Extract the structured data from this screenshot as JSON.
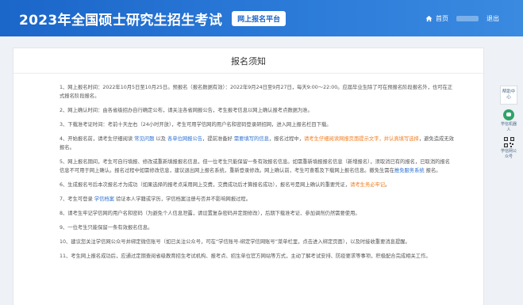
{
  "header": {
    "title": "2023年全国硕士研究生招生考试",
    "badge": "网上报名平台",
    "home_label": "首页",
    "logout_label": "退出"
  },
  "page": {
    "title": "报名须知"
  },
  "side": {
    "help_label": "帮助中心",
    "robot_label": "学信机器人",
    "qr_label": "学信网公众号"
  },
  "notice": {
    "p1": "1、网上报名时间：2022年10月5日至10月25日。预报名（报名数据有效）：2022年9月24日至9月27日，每天9:00～22:00。应届毕业生除了可在预报名阶段报名外，也可在正式报名阶段报名。",
    "p2": "2、网上确认时间：由各省级招办自行确定公布，请关注各省网报公告，考生报考信息以网上确认报考点数据为准。",
    "p3": "3、下载准考证时间：考前十天左右（24小时开放），考生可用学信网的用户名和密码登录研招网，进入网上报名栏目下载。",
    "p4": {
      "t1": "4、开始报名前，请考生仔细阅读 ",
      "l1": "常见问题",
      "t2": " 以及 ",
      "l2": "各单位网报公告",
      "t3": "，提前准备好 ",
      "l3": "需要填写的信息",
      "t4": "，报名过程中，",
      "w1": "请考生仔细阅读网报页面提示文字，并认真填写选择",
      "t5": "，避免造成无效报名。"
    },
    "p5": {
      "t1": "5、网上报名期间，考生可自行填报、修改或重新填报报名信息，但一位考生只能保留一条有效报名信息。如需重新填报报名信息（新增报名），须取消已有的报名，已取消的报名信息不可用于网上确认。报名过程中如需修改信息，建议退出网上报名系统，重新登录修改。网上确认前，考生可查看及下载网上报名信息。撤免生需在",
      "l1": "推免服务系统",
      "t2": " 报名。"
    },
    "p6": {
      "t1": "6、生成报名号后本次报名才为成功（如果选择的报考点采用网上交费，交费成功后才算报名成功），报名号是网上确认的重要凭证，",
      "w1": "请考生务必牢记",
      "t2": "。"
    },
    "p7": {
      "t1": "7、考生可登录 ",
      "l1": "学信档案",
      "t2": " 验证本人学籍或学历，学信档案注册与否并不影响网报过程。"
    },
    "p8": "8、请考生牢记学信网的用户名和密码（为避免个人信息泄露，请设置复杂密码并定期修改），后期下载准考证、参加调剂仍然需要使用。",
    "p9": "9、一位考生只能保留一条有效报名信息。",
    "p10": "10、建议您关注学信网公众号并绑定微信账号（如已关注公众号，可在“学信账号-绑定学信网账号”菜单栏里，点击进入绑定页面），以及时接收重要消息提醒。",
    "p11": "11、考生网上报名成功后，应通过定期查阅省级教育招生考试机构、报考点、招生单位官方网站等方式，主动了解考试安排、防疫要求等事项，积极配合完成相关工作。"
  }
}
